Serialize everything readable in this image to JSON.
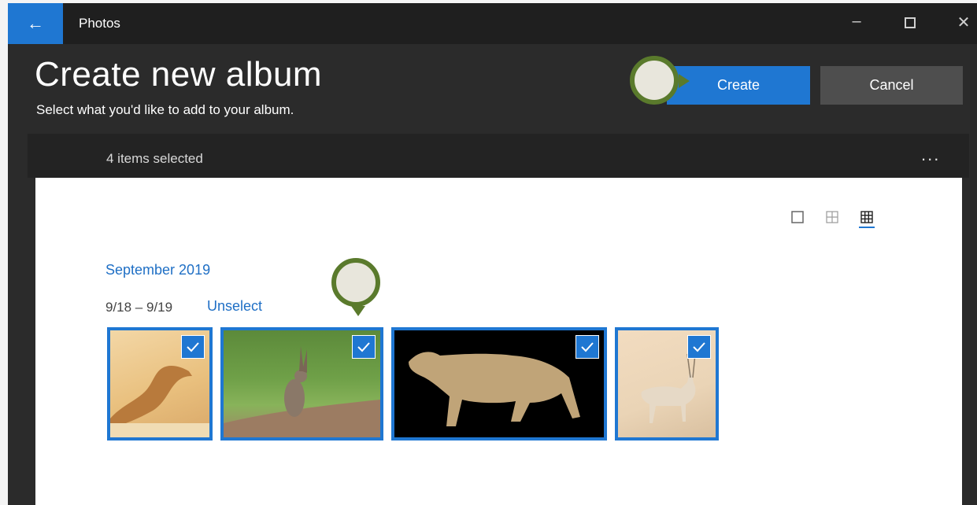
{
  "app": {
    "title": "Photos"
  },
  "header": {
    "title": "Create new album",
    "subtitle": "Select what you'd like to add to your album.",
    "create_label": "Create",
    "cancel_label": "Cancel"
  },
  "selection": {
    "count_label": "4 items selected",
    "more_label": "..."
  },
  "group": {
    "month": "September 2019",
    "range": "9/18 – 9/19",
    "unselect_label": "Unselect"
  },
  "photos": [
    {
      "subject": "camel",
      "selected": true
    },
    {
      "subject": "hare",
      "selected": true
    },
    {
      "subject": "sand cat",
      "selected": true
    },
    {
      "subject": "oryx",
      "selected": true
    }
  ],
  "colors": {
    "accent": "#1f77d2",
    "window_bg": "#2b2b2b",
    "marker": "#5a7a2c"
  },
  "icons": {
    "back": "back-arrow-icon",
    "minimize": "minimize-icon",
    "maximize": "maximize-icon",
    "close": "close-icon",
    "more": "more-icon",
    "checkmark": "checkmark-icon",
    "view_large": "view-large-icon",
    "view_medium": "view-medium-icon",
    "view_small": "view-small-icon"
  }
}
